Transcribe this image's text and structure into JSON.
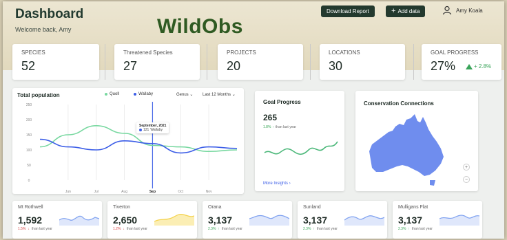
{
  "header": {
    "title": "Dashboard",
    "welcome": "Welcome back, Amy",
    "brand": "WildObs",
    "download_label": "Download Report",
    "add_label": "Add data",
    "user_name": "Amy Koala"
  },
  "stats": [
    {
      "label": "SPECIES",
      "value": "52"
    },
    {
      "label": "Threatened Species",
      "value": "27"
    },
    {
      "label": "PROJECTS",
      "value": "20"
    },
    {
      "label": "LOCATIONS",
      "value": "30"
    },
    {
      "label": "GOAL PROGRESS",
      "value": "27%",
      "trend": "+ 2.8%"
    }
  ],
  "total_population": {
    "title": "Total population",
    "legend": [
      {
        "name": "Quoll",
        "color": "#78d8a0"
      },
      {
        "name": "Wallaby",
        "color": "#3b5de7"
      }
    ],
    "filter_genus": "Genus",
    "filter_period": "Last 12 Months",
    "tooltip_title": "September, 2021",
    "tooltip_series": "Wallaby",
    "tooltip_value": "121"
  },
  "chart_data": {
    "type": "line",
    "title": "Total population",
    "x": [
      "",
      "Jun",
      "Jul",
      "Aug",
      "Sep",
      "Oct",
      "Nov",
      ""
    ],
    "y_ticks": [
      "250",
      "200",
      "150",
      "100",
      "50",
      "0"
    ],
    "ylim": [
      0,
      250
    ],
    "highlight": "Sep",
    "series": [
      {
        "name": "Quoll",
        "color": "#78d8a0",
        "values": [
          110,
          150,
          180,
          155,
          115,
          110,
          95,
          100
        ]
      },
      {
        "name": "Wallaby",
        "color": "#3b5de7",
        "values": [
          135,
          110,
          100,
          130,
          121,
          90,
          110,
          105
        ]
      }
    ]
  },
  "goal_card": {
    "title": "Goal Progress",
    "value": "265",
    "change": "1.8%",
    "change_suffix": "than last year",
    "link": "More Insights",
    "color": "#4cb87a"
  },
  "connections": {
    "title": "Conservation Connections",
    "map_color": "#6f8dee"
  },
  "sites": [
    {
      "name": "Mt Rothwell",
      "value": "1,592",
      "change": "1.5%",
      "dir": "down",
      "suffix": "than last year",
      "color": "#7da0f0"
    },
    {
      "name": "Tiverton",
      "value": "2,650",
      "change": "1.2%",
      "dir": "down",
      "suffix": "than last year",
      "color": "#f4d24c"
    },
    {
      "name": "Orana",
      "value": "3,137",
      "change": "2.3%",
      "dir": "up",
      "suffix": "than last year",
      "color": "#7da0f0"
    },
    {
      "name": "Sunland",
      "value": "3,137",
      "change": "2.3%",
      "dir": "up",
      "suffix": "than last year",
      "color": "#7da0f0"
    },
    {
      "name": "Mulligans Flat",
      "value": "3,137",
      "change": "2.3%",
      "dir": "up",
      "suffix": "than last year",
      "color": "#7da0f0"
    }
  ]
}
